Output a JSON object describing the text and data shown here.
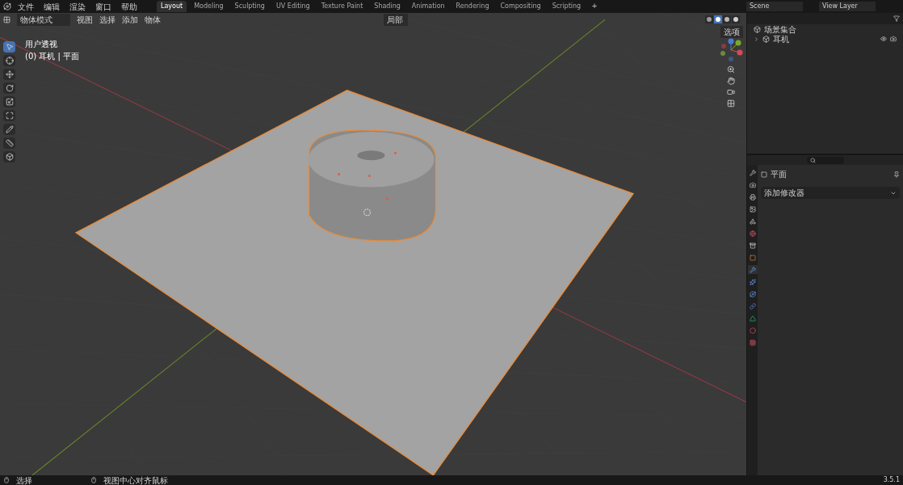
{
  "menu": [
    "文件",
    "编辑",
    "渲染",
    "窗口",
    "帮助"
  ],
  "workspaces": [
    {
      "label": "Layout",
      "selected": true
    },
    {
      "label": "Modeling",
      "selected": false
    },
    {
      "label": "Sculpting",
      "selected": false
    },
    {
      "label": "UV Editing",
      "selected": false
    },
    {
      "label": "Texture Paint",
      "selected": false
    },
    {
      "label": "Shading",
      "selected": false
    },
    {
      "label": "Animation",
      "selected": false
    },
    {
      "label": "Rendering",
      "selected": false
    },
    {
      "label": "Compositing",
      "selected": false
    },
    {
      "label": "Scripting",
      "selected": false
    }
  ],
  "add_workspace": "+",
  "scene": "Scene",
  "view_layer": "View Layer",
  "viewport": {
    "mode": "物体模式",
    "menus": [
      "视图",
      "选择",
      "添加",
      "物体"
    ],
    "orientation": "局部",
    "options": "选项",
    "view_name": "用户透视",
    "object_info": "(0) 耳机 | 平面",
    "tools": [
      {
        "kind": "select",
        "selected": true
      },
      {
        "kind": "cursor",
        "selected": false
      },
      {
        "kind": "move",
        "selected": false
      },
      {
        "kind": "rotate",
        "selected": false
      },
      {
        "kind": "scale",
        "selected": false
      },
      {
        "kind": "transform",
        "selected": false
      },
      {
        "kind": "annotate",
        "selected": false
      },
      {
        "kind": "measure",
        "selected": false
      },
      {
        "kind": "add",
        "selected": false
      }
    ],
    "shading": [
      {
        "kind": "wireframe",
        "selected": false
      },
      {
        "kind": "solid",
        "selected": true
      },
      {
        "kind": "material",
        "selected": false
      },
      {
        "kind": "rendered",
        "selected": false
      }
    ]
  },
  "outliner": {
    "root": "场景集合",
    "children": [
      {
        "label": "耳机",
        "expanded": false
      }
    ]
  },
  "properties": {
    "object_name": "平面",
    "add_modifier": "添加修改器",
    "tabs": [
      {
        "kind": "tool",
        "selected": false
      },
      {
        "kind": "render",
        "selected": false
      },
      {
        "kind": "output",
        "selected": false
      },
      {
        "kind": "view_layer",
        "selected": false
      },
      {
        "kind": "scene",
        "selected": false
      },
      {
        "kind": "world",
        "selected": false
      },
      {
        "kind": "collection",
        "selected": false
      },
      {
        "kind": "object",
        "selected": false
      },
      {
        "kind": "modifiers",
        "selected": true
      },
      {
        "kind": "particles",
        "selected": false
      },
      {
        "kind": "physics",
        "selected": false
      },
      {
        "kind": "constraints",
        "selected": false
      },
      {
        "kind": "data",
        "selected": false
      },
      {
        "kind": "material",
        "selected": false
      },
      {
        "kind": "texture",
        "selected": false
      }
    ]
  },
  "status_bar": {
    "items": [
      "选择",
      "视图中心对齐鼠标"
    ],
    "version": "3.5.1"
  }
}
